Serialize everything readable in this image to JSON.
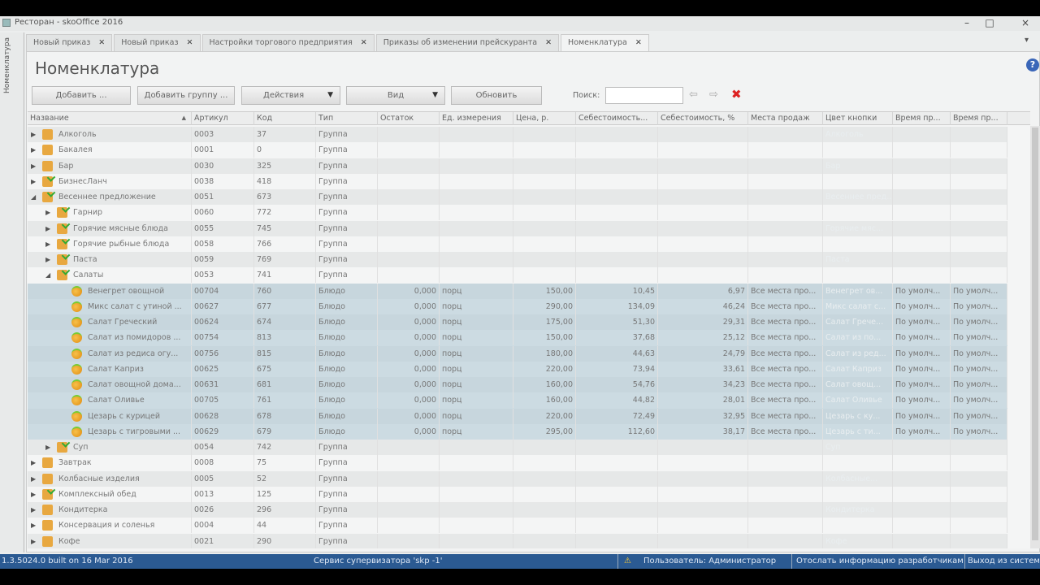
{
  "window": {
    "title": "Ресторан - skoOffice 2016",
    "minimize": "–",
    "maximize": "□",
    "close": "×"
  },
  "side_strip": {
    "label": "Номенклатура"
  },
  "tabs": [
    {
      "label": "Новый приказ",
      "active": false
    },
    {
      "label": "Новый приказ",
      "active": false
    },
    {
      "label": "Настройки торгового предприятия",
      "active": false
    },
    {
      "label": "Приказы об изменении прейскуранта",
      "active": false
    },
    {
      "label": "Номенклатура",
      "active": true
    }
  ],
  "tab_close": "✕",
  "page": {
    "title": "Номенклатура",
    "help": "?"
  },
  "toolbar": {
    "add": "Добавить ...",
    "add_group": "Добавить группу ...",
    "actions": "Действия",
    "view": "Вид",
    "refresh": "Обновить",
    "search_label": "Поиск:",
    "search_value": "",
    "dropdown_arrow": "▼",
    "prev": "⇦",
    "next": "⇨",
    "clear": "✖"
  },
  "columns": [
    "Название",
    "Артикул",
    "Код",
    "Тип",
    "Остаток",
    "Ед. измерения",
    "Цена, р.",
    "Себестоимость...",
    "Себестоимость, %",
    "Места продаж",
    "Цвет кнопки",
    "Время пр...",
    "Время пр..."
  ],
  "sort_indicator": "▲",
  "rows": [
    {
      "level": 0,
      "state": "collapsed",
      "icon": "folder",
      "name": "Алкоголь",
      "art": "0003",
      "code": "37",
      "type": "Группа",
      "color": "Алкоголь"
    },
    {
      "level": 0,
      "state": "collapsed",
      "icon": "folder",
      "name": "Бакалея",
      "art": "0001",
      "code": "0",
      "type": "Группа",
      "color": ""
    },
    {
      "level": 0,
      "state": "collapsed",
      "icon": "folder",
      "name": "Бар",
      "art": "0030",
      "code": "325",
      "type": "Группа",
      "color": "Бар"
    },
    {
      "level": 0,
      "state": "collapsed",
      "icon": "folder-check",
      "name": "БизнесЛанч",
      "art": "0038",
      "code": "418",
      "type": "Группа",
      "color": ""
    },
    {
      "level": 0,
      "state": "expanded",
      "icon": "folder-check",
      "name": "Весеннее предложение",
      "art": "0051",
      "code": "673",
      "type": "Группа",
      "color": "Весеннее пред..."
    },
    {
      "level": 1,
      "state": "collapsed",
      "icon": "folder-check",
      "name": "Гарнир",
      "art": "0060",
      "code": "772",
      "type": "Группа",
      "color": ""
    },
    {
      "level": 1,
      "state": "collapsed",
      "icon": "folder-check",
      "name": "Горячие мясные блюда",
      "art": "0055",
      "code": "745",
      "type": "Группа",
      "color": "Горячие мяс..."
    },
    {
      "level": 1,
      "state": "collapsed",
      "icon": "folder-check",
      "name": "Горячие рыбные блюда",
      "art": "0058",
      "code": "766",
      "type": "Группа",
      "color": ""
    },
    {
      "level": 1,
      "state": "collapsed",
      "icon": "folder-check",
      "name": "Паста",
      "art": "0059",
      "code": "769",
      "type": "Группа",
      "color": "Паста"
    },
    {
      "level": 1,
      "state": "expanded",
      "icon": "folder-check",
      "name": "Салаты",
      "art": "0053",
      "code": "741",
      "type": "Группа",
      "color": ""
    },
    {
      "level": 2,
      "icon": "dish",
      "sel": true,
      "name": "Венегрет овощной",
      "art": "00704",
      "code": "760",
      "type": "Блюдо",
      "stock": "0,000",
      "unit": "порц",
      "price": "150,00",
      "cost": "10,45",
      "costp": "6,97",
      "places": "Все места про...",
      "color": "Венегрет ов...",
      "t1": "По умолч...",
      "t2": "По умолч..."
    },
    {
      "level": 2,
      "icon": "dish",
      "sel": true,
      "name": "Микс салат с утиной ...",
      "art": "00627",
      "code": "677",
      "type": "Блюдо",
      "stock": "0,000",
      "unit": "порц",
      "price": "290,00",
      "cost": "134,09",
      "costp": "46,24",
      "places": "Все места про...",
      "color": "Микс салат с...",
      "t1": "По умолч...",
      "t2": "По умолч..."
    },
    {
      "level": 2,
      "icon": "dish",
      "sel": true,
      "name": "Салат Греческий",
      "art": "00624",
      "code": "674",
      "type": "Блюдо",
      "stock": "0,000",
      "unit": "порц",
      "price": "175,00",
      "cost": "51,30",
      "costp": "29,31",
      "places": "Все места про...",
      "color": "Салат Грече...",
      "t1": "По умолч...",
      "t2": "По умолч..."
    },
    {
      "level": 2,
      "icon": "dish",
      "sel": true,
      "name": "Салат из помидоров ...",
      "art": "00754",
      "code": "813",
      "type": "Блюдо",
      "stock": "0,000",
      "unit": "порц",
      "price": "150,00",
      "cost": "37,68",
      "costp": "25,12",
      "places": "Все места про...",
      "color": "Салат из по...",
      "t1": "По умолч...",
      "t2": "По умолч..."
    },
    {
      "level": 2,
      "icon": "dish",
      "sel": true,
      "name": "Салат из редиса огу...",
      "art": "00756",
      "code": "815",
      "type": "Блюдо",
      "stock": "0,000",
      "unit": "порц",
      "price": "180,00",
      "cost": "44,63",
      "costp": "24,79",
      "places": "Все места про...",
      "color": "Салат из ред...",
      "t1": "По умолч...",
      "t2": "По умолч..."
    },
    {
      "level": 2,
      "icon": "dish",
      "sel": true,
      "name": "Салат Каприз",
      "art": "00625",
      "code": "675",
      "type": "Блюдо",
      "stock": "0,000",
      "unit": "порц",
      "price": "220,00",
      "cost": "73,94",
      "costp": "33,61",
      "places": "Все места про...",
      "color": "Салат Каприз",
      "t1": "По умолч...",
      "t2": "По умолч..."
    },
    {
      "level": 2,
      "icon": "dish",
      "sel": true,
      "name": "Салат овощной дома...",
      "art": "00631",
      "code": "681",
      "type": "Блюдо",
      "stock": "0,000",
      "unit": "порц",
      "price": "160,00",
      "cost": "54,76",
      "costp": "34,23",
      "places": "Все места про...",
      "color": "Салат овощ...",
      "t1": "По умолч...",
      "t2": "По умолч..."
    },
    {
      "level": 2,
      "icon": "dish",
      "sel": true,
      "name": "Салат Оливье",
      "art": "00705",
      "code": "761",
      "type": "Блюдо",
      "stock": "0,000",
      "unit": "порц",
      "price": "160,00",
      "cost": "44,82",
      "costp": "28,01",
      "places": "Все места про...",
      "color": "Салат Оливье",
      "t1": "По умолч...",
      "t2": "По умолч..."
    },
    {
      "level": 2,
      "icon": "dish",
      "sel": true,
      "name": "Цезарь с курицей",
      "art": "00628",
      "code": "678",
      "type": "Блюдо",
      "stock": "0,000",
      "unit": "порц",
      "price": "220,00",
      "cost": "72,49",
      "costp": "32,95",
      "places": "Все места про...",
      "color": "Цезарь с ку...",
      "t1": "По умолч...",
      "t2": "По умолч..."
    },
    {
      "level": 2,
      "icon": "dish",
      "sel": true,
      "name": "Цезарь с тигровыми ...",
      "art": "00629",
      "code": "679",
      "type": "Блюдо",
      "stock": "0,000",
      "unit": "порц",
      "price": "295,00",
      "cost": "112,60",
      "costp": "38,17",
      "places": "Все места про...",
      "color": "Цезарь с ти...",
      "t1": "По умолч...",
      "t2": "По умолч..."
    },
    {
      "level": 1,
      "state": "collapsed",
      "icon": "folder-check",
      "name": "Суп",
      "art": "0054",
      "code": "742",
      "type": "Группа",
      "color": "Суп"
    },
    {
      "level": 0,
      "state": "collapsed",
      "icon": "folder",
      "name": "Завтрак",
      "art": "0008",
      "code": "75",
      "type": "Группа",
      "color": ""
    },
    {
      "level": 0,
      "state": "collapsed",
      "icon": "folder",
      "name": "Колбасные изделия",
      "art": "0005",
      "code": "52",
      "type": "Группа",
      "color": "Колбасные..."
    },
    {
      "level": 0,
      "state": "collapsed",
      "icon": "folder-check",
      "name": "Комплексный обед",
      "art": "0013",
      "code": "125",
      "type": "Группа",
      "color": ""
    },
    {
      "level": 0,
      "state": "collapsed",
      "icon": "folder",
      "name": "Кондитерка",
      "art": "0026",
      "code": "296",
      "type": "Группа",
      "color": "Кондитерка"
    },
    {
      "level": 0,
      "state": "collapsed",
      "icon": "folder",
      "name": "Консервация и соленья",
      "art": "0004",
      "code": "44",
      "type": "Группа",
      "color": ""
    },
    {
      "level": 0,
      "state": "collapsed",
      "icon": "folder",
      "name": "Кофе",
      "art": "0021",
      "code": "290",
      "type": "Группа",
      "color": "Кофе"
    }
  ],
  "status": {
    "version": "1.3.5024.0 built on 16 Mar 2016",
    "server": "Сервис супервизатора 'skp -1'",
    "warning_icon": "⚠",
    "user": "Пользователь: Администратор",
    "send_info": "Отослать информацию разработчикам",
    "exit": "Выход из систем..."
  },
  "colors": {
    "status_bar": "#2b5a92",
    "selection": "#ccdbe2",
    "folder": "#e8a840"
  }
}
